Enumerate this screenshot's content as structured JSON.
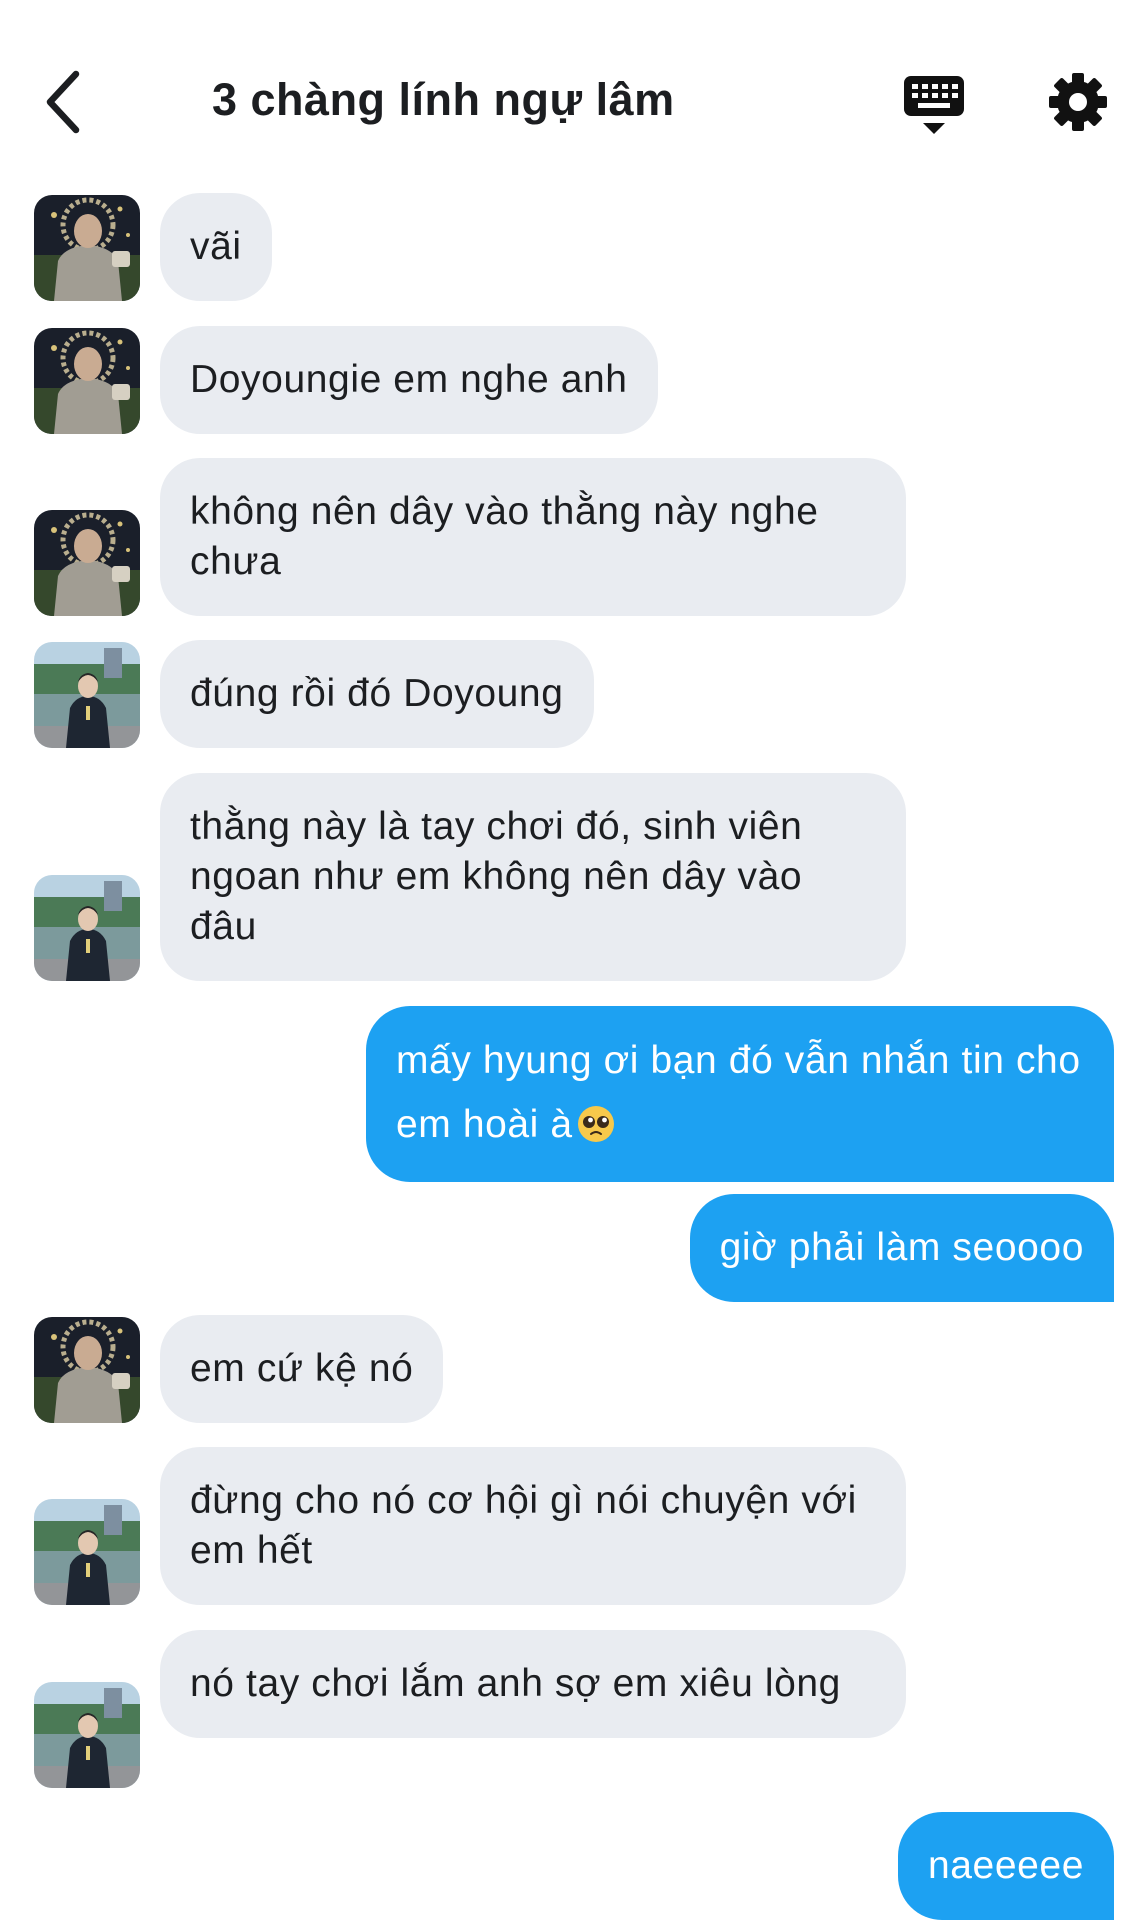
{
  "header": {
    "title": "3 chàng lính ngự lâm"
  },
  "icons": {
    "back": "chevron-left-icon",
    "keyboard": "keyboard-icon",
    "settings": "gear-icon"
  },
  "colors": {
    "incoming_bubble": "#e9ecf1",
    "outgoing_bubble": "#1da1f2",
    "text": "#1c1e21"
  },
  "messages": [
    {
      "sender": "a",
      "text": "vãi"
    },
    {
      "sender": "a",
      "text": "Doyoungie em nghe anh"
    },
    {
      "sender": "a",
      "text": "không nên dây vào thằng này nghe chưa"
    },
    {
      "sender": "b",
      "text": "đúng rồi đó Doyoung"
    },
    {
      "sender": "b",
      "text": "thằng này là tay chơi đó, sinh viên ngoan như em không nên dây vào đâu"
    },
    {
      "sender": "me",
      "text": "mấy hyung ơi bạn đó vẫn nhắn tin cho em hoài à",
      "emoji": "pleading-face-emoji"
    },
    {
      "sender": "me",
      "text": "giờ phải làm seoooo"
    },
    {
      "sender": "a",
      "text": "em cứ kệ nó"
    },
    {
      "sender": "b",
      "text": "đừng cho nó cơ hội gì nói chuyện với em hết"
    },
    {
      "sender": "b",
      "text": "nó tay chơi lắm anh sợ em xiêu lòng"
    },
    {
      "sender": "me",
      "text": "naeeeee"
    }
  ]
}
